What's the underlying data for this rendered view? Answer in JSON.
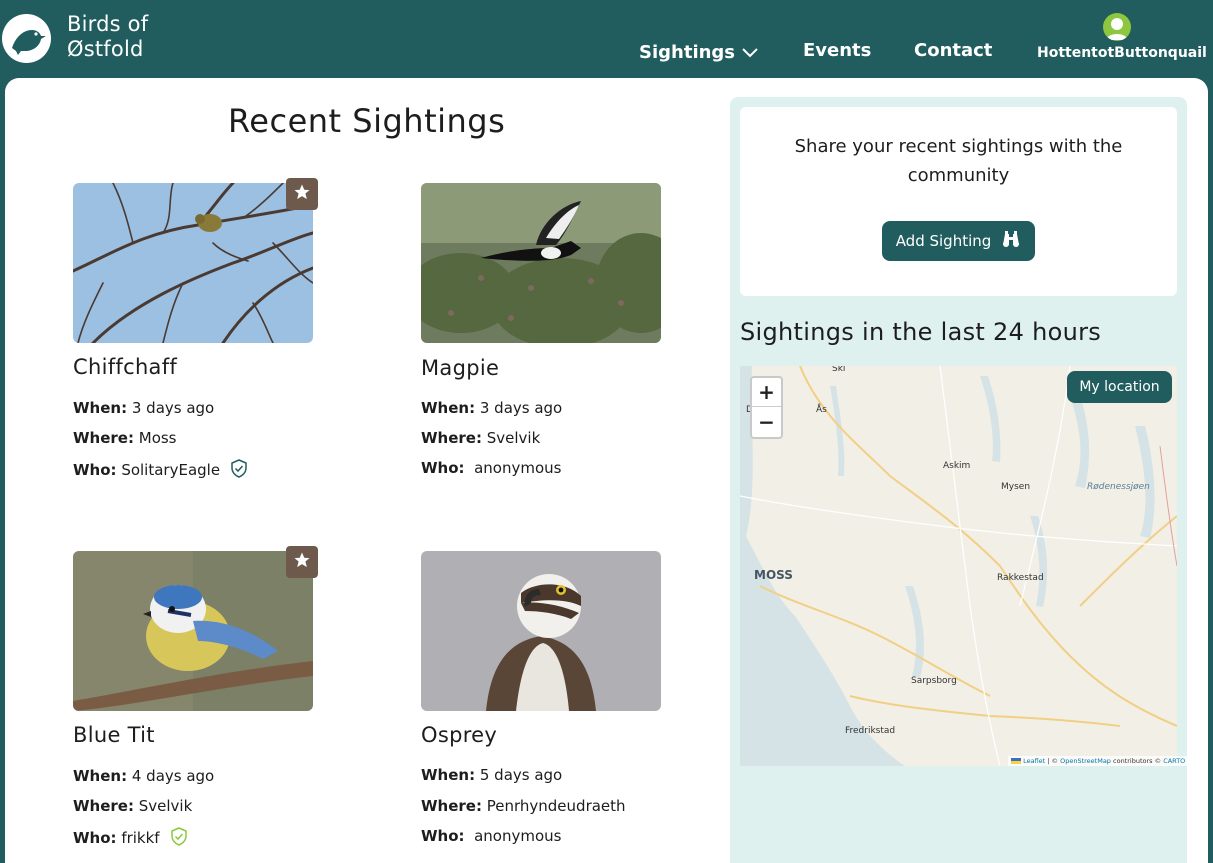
{
  "brand": {
    "line1": "Birds of",
    "line2": "Østfold"
  },
  "nav": {
    "sightings": "Sightings",
    "events": "Events",
    "contact": "Contact",
    "username": "HottentotButtonquail"
  },
  "page_title": "Recent Sightings",
  "labels": {
    "when": "When:",
    "where": "Where:",
    "who": "Who:"
  },
  "sightings": [
    {
      "name": "Chiffchaff",
      "when": "3 days ago",
      "where": "Moss",
      "who": "SolitaryEagle",
      "verified": true,
      "verified_color": "#215d5e",
      "favorite": true
    },
    {
      "name": "Magpie",
      "when": "3 days ago",
      "where": "Svelvik",
      "who": "anonymous",
      "verified": false,
      "favorite": false
    },
    {
      "name": "Blue Tit",
      "when": "4 days ago",
      "where": "Svelvik",
      "who": "frikkf",
      "verified": true,
      "verified_color": "#8dc63f",
      "favorite": true
    },
    {
      "name": "Osprey",
      "when": "5 days ago",
      "where": "Penrhyndeudraeth",
      "who": "anonymous",
      "verified": false,
      "favorite": false
    }
  ],
  "sidebar": {
    "share_text": "Share your recent sightings with the community",
    "add_button": "Add Sighting",
    "map_title": "Sightings in the last 24 hours",
    "my_location": "My location",
    "zoom_in": "+",
    "zoom_out": "−",
    "map_places": [
      "Ski",
      "Ås",
      "D",
      "Askim",
      "Mysen",
      "Rødenessjøen",
      "MOSS",
      "Rakkestad",
      "Sarpsborg",
      "Fredrikstad"
    ],
    "attribution": {
      "leaflet": "Leaflet",
      "sep": " | © ",
      "osm": "OpenStreetMap",
      "rest": " contributors © ",
      "carto": "CARTO"
    }
  },
  "colors": {
    "brand": "#215d5e",
    "sidebar_bg": "#dff1ef",
    "fav_bg": "#6e5a4c",
    "avatar": "#8dc63f"
  }
}
